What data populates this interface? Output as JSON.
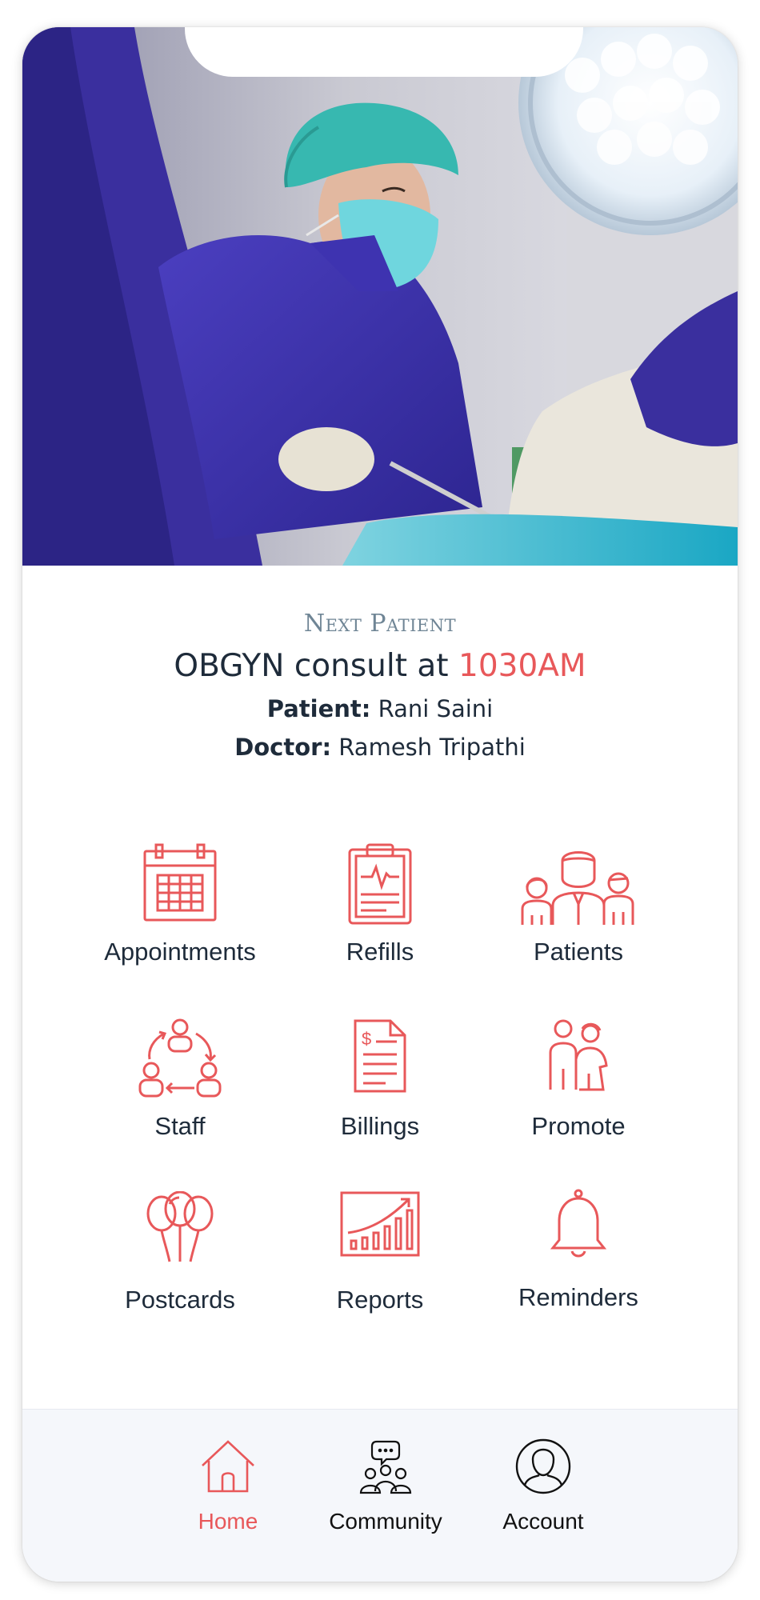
{
  "next_patient": {
    "label": "Next Patient",
    "consult_prefix": "OBGYN consult at ",
    "consult_time": "1030AM",
    "patient_label": "Patient:",
    "patient_name": " Rani Saini",
    "doctor_label": "Doctor:",
    "doctor_name": " Ramesh Tripathi"
  },
  "menu": {
    "appointments": "Appointments",
    "refills": "Refills",
    "patients": "Patients",
    "staff": "Staff",
    "billings": "Billings",
    "promote": "Promote",
    "postcards": "Postcards",
    "reports": "Reports",
    "reminders": "Reminders"
  },
  "tabs": {
    "home": "Home",
    "community": "Community",
    "account": "Account"
  },
  "colors": {
    "accent": "#e8585a",
    "text": "#1e2b3a",
    "label_muted": "#6f8595",
    "tabbar_bg": "#f5f7fb"
  },
  "icons": {
    "appointments": "calendar-icon",
    "refills": "clipboard-heartbeat-icon",
    "patients": "family-group-icon",
    "staff": "team-cycle-icon",
    "billings": "invoice-icon",
    "promote": "couple-icon",
    "postcards": "balloons-icon",
    "reports": "growth-chart-icon",
    "reminders": "bell-icon",
    "home": "house-icon",
    "community": "group-chat-icon",
    "account": "user-circle-icon"
  }
}
